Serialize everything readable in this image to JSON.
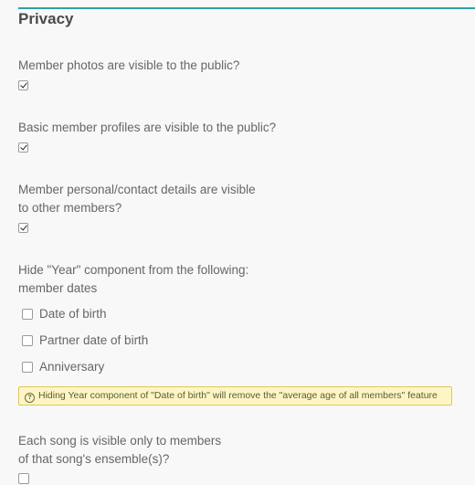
{
  "section": {
    "title": "Privacy"
  },
  "settings": {
    "photos_public": {
      "line1": "Member photos are visible to the public?",
      "checked": true
    },
    "profiles_public": {
      "line1": "Basic member profiles are visible to the public?",
      "checked": true
    },
    "personal_details": {
      "line1": "Member personal/contact details are visible",
      "line2": "to other members?",
      "checked": true
    },
    "hide_year": {
      "line1": "Hide \"Year\" component from the following:",
      "line2": "member dates",
      "options": [
        {
          "label": "Date of birth",
          "checked": false
        },
        {
          "label": "Partner date of birth",
          "checked": false
        },
        {
          "label": "Anniversary",
          "checked": false
        }
      ],
      "notice_icon": "question-circle-icon",
      "notice": "Hiding Year component of \"Date of birth\" will remove the \"average age of all members\" feature"
    },
    "song_visibility": {
      "line1": "Each song is visible only to members",
      "line2": "of that song's ensemble(s)?",
      "checked": false
    }
  },
  "colors": {
    "accent": "#2ba3a8",
    "notice_bg": "#fdf6c4",
    "notice_border": "#e0c85a"
  }
}
